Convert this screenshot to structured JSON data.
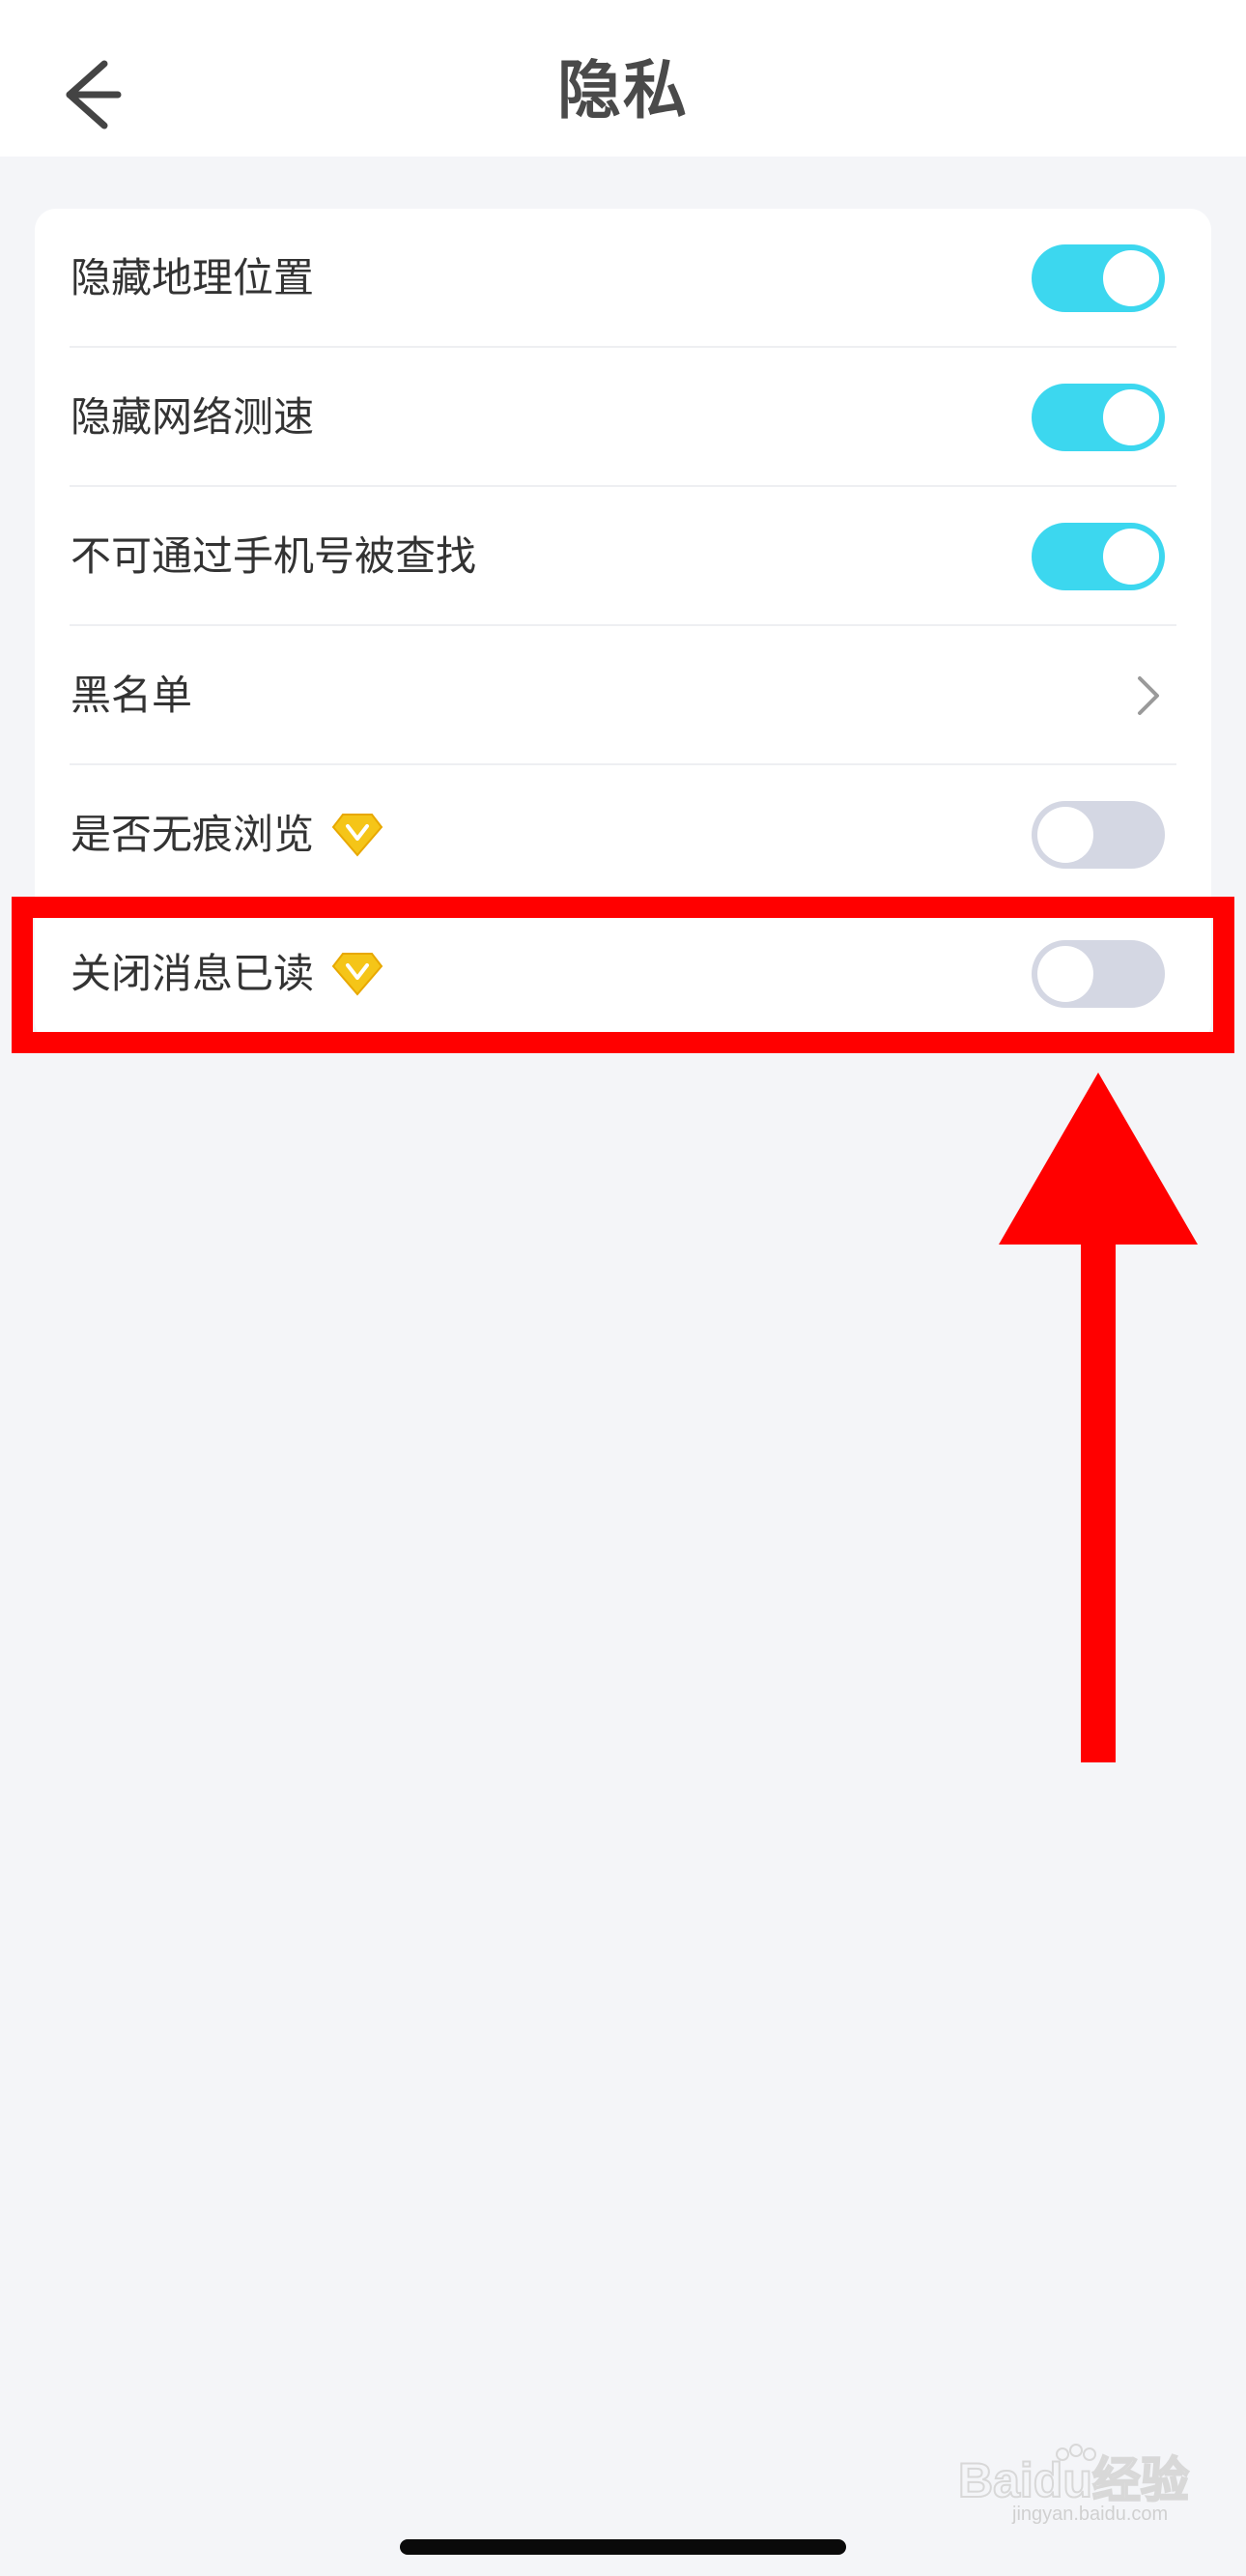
{
  "header": {
    "title": "隐私",
    "back_icon": "back-arrow-icon"
  },
  "colors": {
    "accent": "#3cd7ef",
    "toggle_off": "#d4d7e3",
    "annotation": "#ff0000",
    "vip_gold": "#f5c518"
  },
  "settings": [
    {
      "label": "隐藏地理位置",
      "control": "toggle",
      "state": "on"
    },
    {
      "label": "隐藏网络测速",
      "control": "toggle",
      "state": "on"
    },
    {
      "label": "不可通过手机号被查找",
      "control": "toggle",
      "state": "on"
    },
    {
      "label": "黑名单",
      "control": "chevron"
    },
    {
      "label": "是否无痕浏览",
      "control": "toggle",
      "state": "off",
      "vip": true
    },
    {
      "label": "关闭消息已读",
      "control": "toggle",
      "state": "off",
      "vip": true
    }
  ],
  "annotation": {
    "highlight_target": "关闭消息已读",
    "arrow_icon": "red-arrow-up-icon"
  },
  "watermark": {
    "text": "Baidu经验",
    "subtext": "jingyan.baidu.com"
  }
}
